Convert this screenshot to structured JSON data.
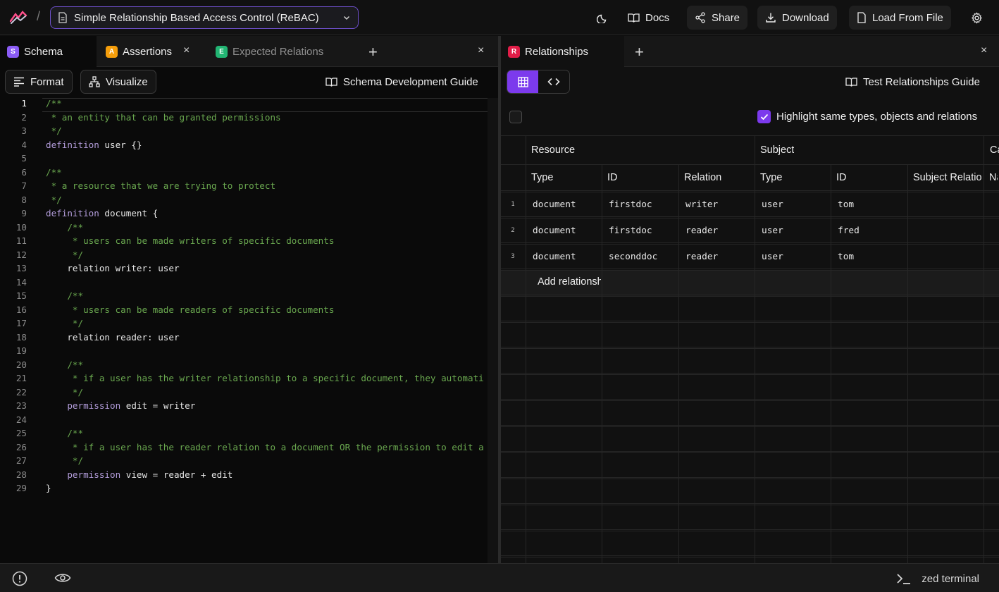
{
  "header": {
    "separator": "/",
    "project_title": "Simple Relationship Based Access Control (ReBAC)",
    "docs_label": "Docs",
    "share_label": "Share",
    "download_label": "Download",
    "load_label": "Load From File"
  },
  "left_panel": {
    "tabs": [
      {
        "badge": "S",
        "label": "Schema",
        "color": "#8b5cf6"
      },
      {
        "badge": "A",
        "label": "Assertions",
        "color": "#f59e0b"
      },
      {
        "badge": "E",
        "label": "Expected Relations",
        "color": "#22b573"
      }
    ],
    "close_symbol": "×",
    "add_symbol": "+",
    "format_label": "Format",
    "visualize_label": "Visualize",
    "guide_label": "Schema Development Guide"
  },
  "code_lines": [
    [
      {
        "t": "/**",
        "c": "cm"
      }
    ],
    [
      {
        "t": " * an entity that can be granted permissions",
        "c": "cm"
      }
    ],
    [
      {
        "t": " */",
        "c": "cm"
      }
    ],
    [
      {
        "t": "definition",
        "c": "kw"
      },
      {
        "t": " user {}",
        "c": ""
      }
    ],
    [],
    [
      {
        "t": "/**",
        "c": "cm"
      }
    ],
    [
      {
        "t": " * a resource that we are trying to protect",
        "c": "cm"
      }
    ],
    [
      {
        "t": " */",
        "c": "cm"
      }
    ],
    [
      {
        "t": "definition",
        "c": "kw"
      },
      {
        "t": " document {",
        "c": ""
      }
    ],
    [
      {
        "t": "    /**",
        "c": "cm"
      }
    ],
    [
      {
        "t": "     * users can be made writers of specific documents",
        "c": "cm"
      }
    ],
    [
      {
        "t": "     */",
        "c": "cm"
      }
    ],
    [
      {
        "t": "    relation writer: user",
        "c": ""
      }
    ],
    [],
    [
      {
        "t": "    /**",
        "c": "cm"
      }
    ],
    [
      {
        "t": "     * users can be made readers of specific documents",
        "c": "cm"
      }
    ],
    [
      {
        "t": "     */",
        "c": "cm"
      }
    ],
    [
      {
        "t": "    relation reader: user",
        "c": ""
      }
    ],
    [],
    [
      {
        "t": "    /**",
        "c": "cm"
      }
    ],
    [
      {
        "t": "     * if a user has the writer relationship to a specific document, they automati",
        "c": "cm"
      }
    ],
    [
      {
        "t": "     */",
        "c": "cm"
      }
    ],
    [
      {
        "t": "    permission",
        "c": "kw"
      },
      {
        "t": " edit = writer",
        "c": ""
      }
    ],
    [],
    [
      {
        "t": "    /**",
        "c": "cm"
      }
    ],
    [
      {
        "t": "     * if a user has the reader relation to a document OR the permission to edit a",
        "c": "cm"
      }
    ],
    [
      {
        "t": "     */",
        "c": "cm"
      }
    ],
    [
      {
        "t": "    permission",
        "c": "kw"
      },
      {
        "t": " view = reader + edit",
        "c": ""
      }
    ],
    [
      {
        "t": "}",
        "c": ""
      }
    ]
  ],
  "right_panel": {
    "tab": {
      "badge": "R",
      "label": "Relationships",
      "color": "#e11d48"
    },
    "add_symbol": "+",
    "close_symbol": "×",
    "guide_label": "Test Relationships Guide",
    "highlight_label": "Highlight same types, objects and relations",
    "highlight_checked": true,
    "group_headers": [
      "Resource",
      "Subject",
      "Ca"
    ],
    "columns": [
      "Type",
      "ID",
      "Relation",
      "Type",
      "ID",
      "Subject Relation",
      "Na"
    ],
    "rows": [
      {
        "num": "1",
        "cells": [
          "document",
          "firstdoc",
          "writer",
          "user",
          "tom",
          ""
        ]
      },
      {
        "num": "2",
        "cells": [
          "document",
          "firstdoc",
          "reader",
          "user",
          "fred",
          ""
        ]
      },
      {
        "num": "3",
        "cells": [
          "document",
          "seconddoc",
          "reader",
          "user",
          "tom",
          ""
        ]
      }
    ],
    "add_row_label": "Add relationship"
  },
  "footer": {
    "terminal_label": "zed terminal"
  }
}
